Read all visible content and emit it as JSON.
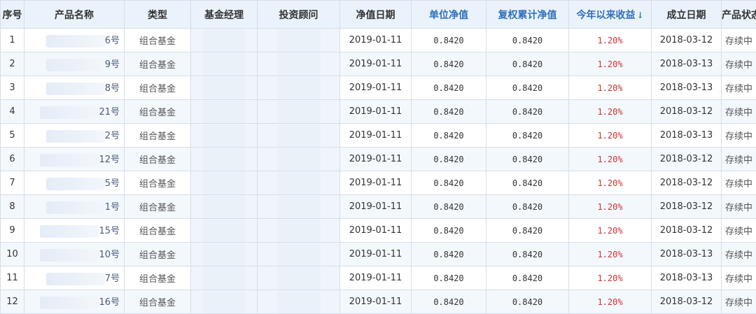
{
  "columns": {
    "index": "序号",
    "name": "产品名称",
    "type": "类型",
    "manager": "基金经理",
    "advisor": "投资顾问",
    "nav_date": "净值日期",
    "unit_nav": "单位净值",
    "cum_nav": "复权累计净值",
    "ytd": "今年以来收益",
    "ytd_sort_icon": "↓",
    "inception": "成立日期",
    "status": "产品状态"
  },
  "colors": {
    "header_bg": "#eaf2fb",
    "header_accent": "#2f6fbd",
    "return_red": "#d13131",
    "row_alt_bg": "#f3f8fd",
    "border": "#d5dee9"
  },
  "rows": [
    {
      "index": "1",
      "name_suffix": "6号",
      "type": "组合基金",
      "nav_date": "2019-01-11",
      "unit_nav": "0.8420",
      "cum_nav": "0.8420",
      "ytd": "1.20%",
      "inception": "2018-03-12",
      "status": "存续中"
    },
    {
      "index": "2",
      "name_suffix": "9号",
      "type": "组合基金",
      "nav_date": "2019-01-11",
      "unit_nav": "0.8420",
      "cum_nav": "0.8420",
      "ytd": "1.20%",
      "inception": "2018-03-13",
      "status": "存续中"
    },
    {
      "index": "3",
      "name_suffix": "8号",
      "type": "组合基金",
      "nav_date": "2019-01-11",
      "unit_nav": "0.8420",
      "cum_nav": "0.8420",
      "ytd": "1.20%",
      "inception": "2018-03-13",
      "status": "存续中"
    },
    {
      "index": "4",
      "name_suffix": "21号",
      "type": "组合基金",
      "nav_date": "2019-01-11",
      "unit_nav": "0.8420",
      "cum_nav": "0.8420",
      "ytd": "1.20%",
      "inception": "2018-03-12",
      "status": "存续中"
    },
    {
      "index": "5",
      "name_suffix": "2号",
      "type": "组合基金",
      "nav_date": "2019-01-11",
      "unit_nav": "0.8420",
      "cum_nav": "0.8420",
      "ytd": "1.20%",
      "inception": "2018-03-13",
      "status": "存续中"
    },
    {
      "index": "6",
      "name_suffix": "12号",
      "type": "组合基金",
      "nav_date": "2019-01-11",
      "unit_nav": "0.8420",
      "cum_nav": "0.8420",
      "ytd": "1.20%",
      "inception": "2018-03-12",
      "status": "存续中"
    },
    {
      "index": "7",
      "name_suffix": "5号",
      "type": "组合基金",
      "nav_date": "2019-01-11",
      "unit_nav": "0.8420",
      "cum_nav": "0.8420",
      "ytd": "1.20%",
      "inception": "2018-03-12",
      "status": "存续中"
    },
    {
      "index": "8",
      "name_suffix": "1号",
      "type": "组合基金",
      "nav_date": "2019-01-11",
      "unit_nav": "0.8420",
      "cum_nav": "0.8420",
      "ytd": "1.20%",
      "inception": "2018-03-12",
      "status": "存续中"
    },
    {
      "index": "9",
      "name_suffix": "15号",
      "type": "组合基金",
      "nav_date": "2019-01-11",
      "unit_nav": "0.8420",
      "cum_nav": "0.8420",
      "ytd": "1.20%",
      "inception": "2018-03-12",
      "status": "存续中"
    },
    {
      "index": "10",
      "name_suffix": "10号",
      "type": "组合基金",
      "nav_date": "2019-01-11",
      "unit_nav": "0.8420",
      "cum_nav": "0.8420",
      "ytd": "1.20%",
      "inception": "2018-03-13",
      "status": "存续中"
    },
    {
      "index": "11",
      "name_suffix": "7号",
      "type": "组合基金",
      "nav_date": "2019-01-11",
      "unit_nav": "0.8420",
      "cum_nav": "0.8420",
      "ytd": "1.20%",
      "inception": "2018-03-13",
      "status": "存续中"
    },
    {
      "index": "12",
      "name_suffix": "16号",
      "type": "组合基金",
      "nav_date": "2019-01-11",
      "unit_nav": "0.8420",
      "cum_nav": "0.8420",
      "ytd": "1.20%",
      "inception": "2018-03-12",
      "status": "存续中"
    }
  ]
}
